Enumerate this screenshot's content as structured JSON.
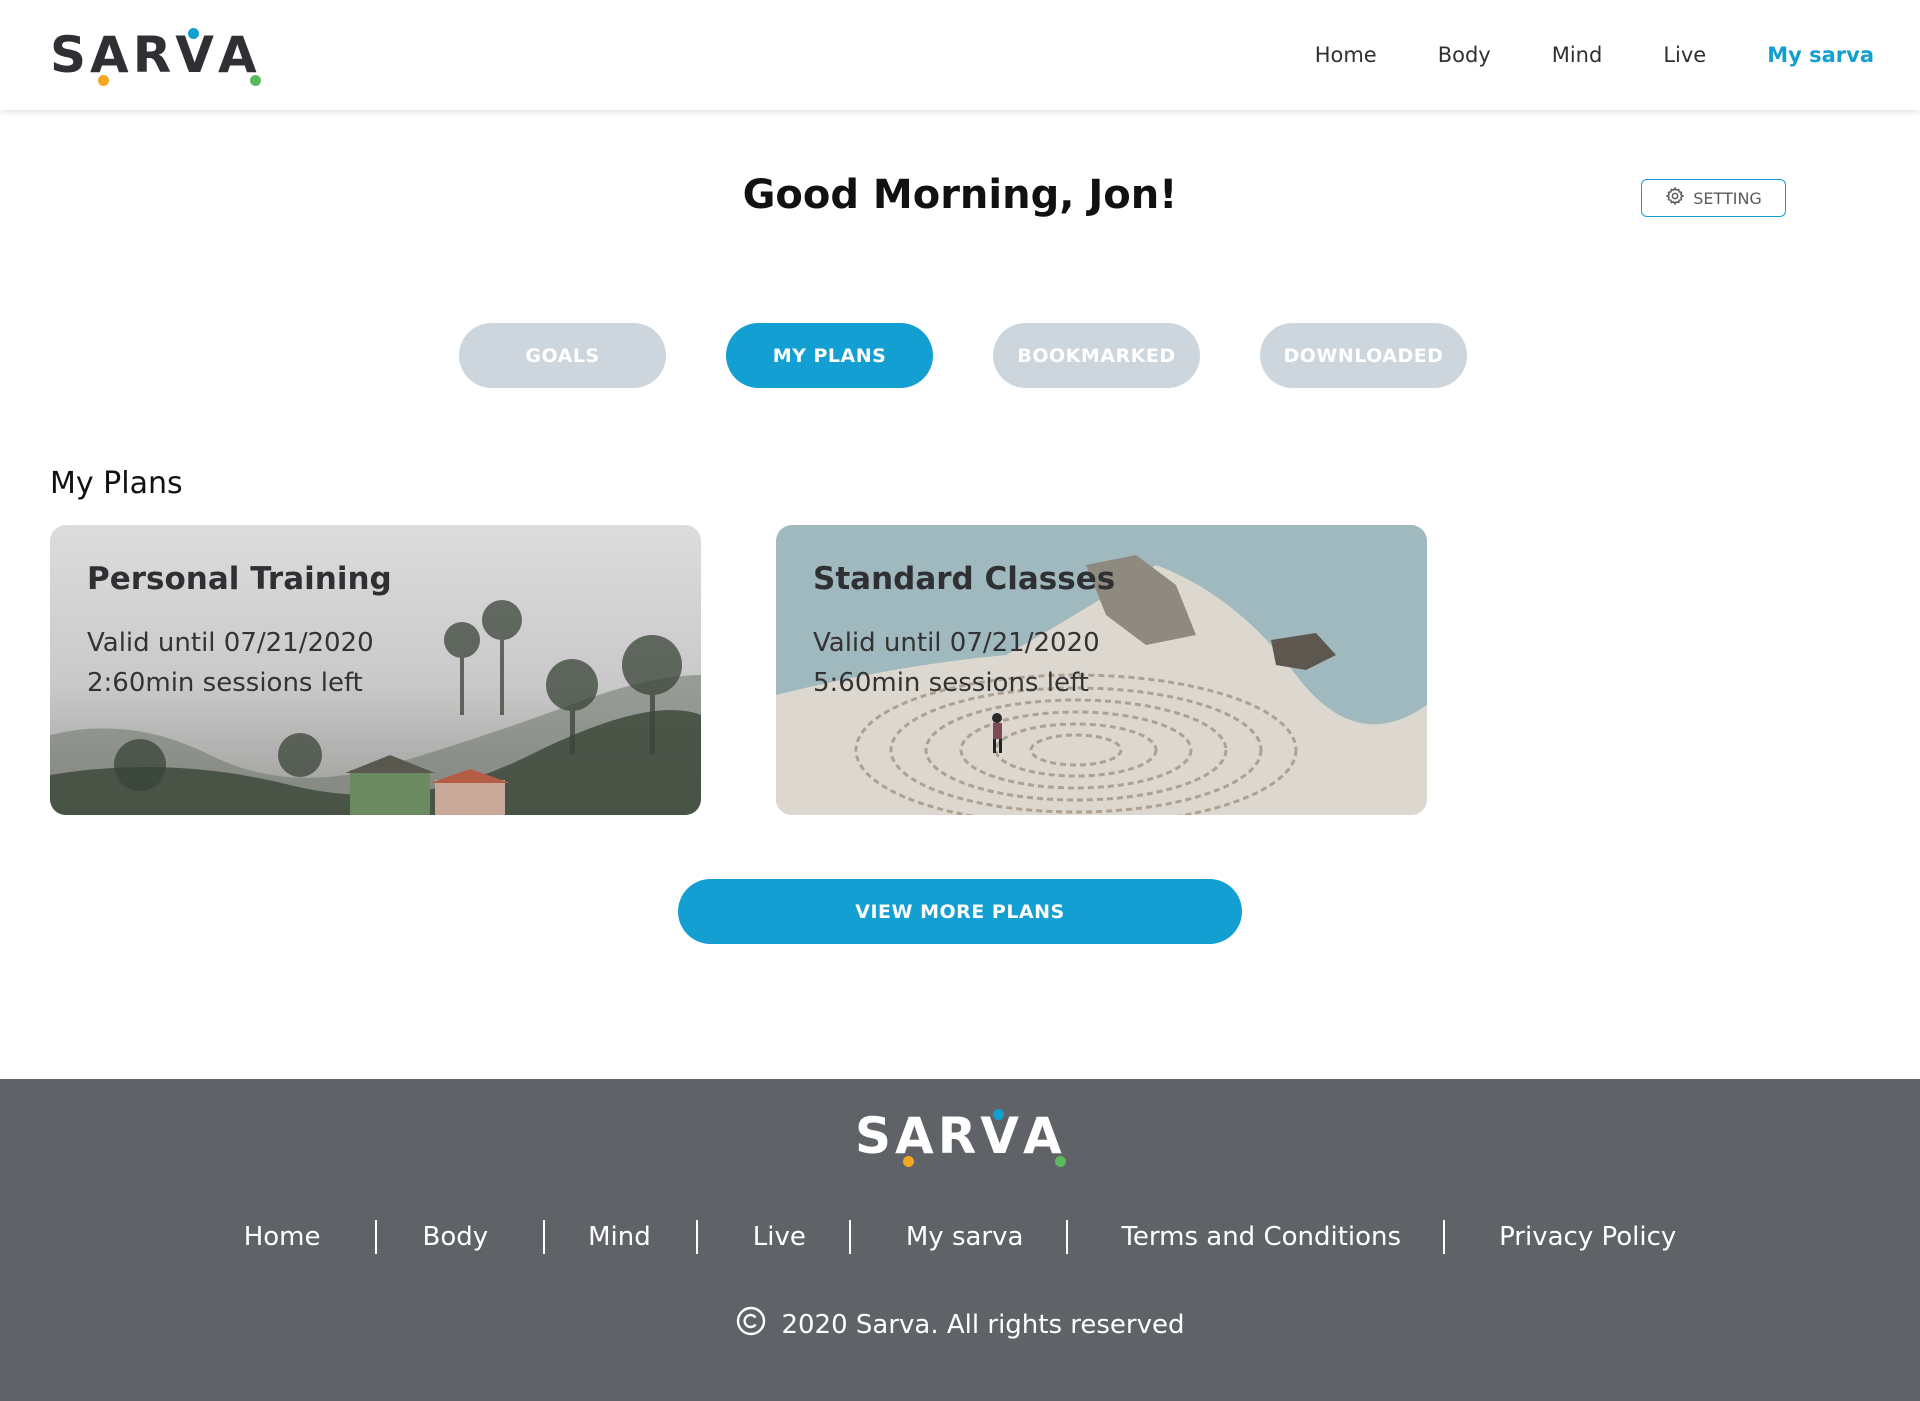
{
  "brand": {
    "name_letters": [
      "S",
      "A",
      "R",
      "V",
      "A"
    ],
    "dot_colors": [
      "#f5a623",
      "#139fd1",
      "#5cb85c"
    ]
  },
  "header": {
    "nav": [
      {
        "label": "Home",
        "active": false
      },
      {
        "label": "Body",
        "active": false
      },
      {
        "label": "Mind",
        "active": false
      },
      {
        "label": "Live",
        "active": false
      },
      {
        "label": "My sarva",
        "active": true
      }
    ]
  },
  "main": {
    "greeting": "Good Morning, Jon!",
    "setting_label": "SETTING",
    "tabs": [
      {
        "label": "GOALS",
        "active": false
      },
      {
        "label": "MY PLANS",
        "active": true
      },
      {
        "label": "BOOKMARKED",
        "active": false
      },
      {
        "label": "DOWNLOADED",
        "active": false
      }
    ],
    "section_title": "My Plans",
    "plans": [
      {
        "title": "Personal Training",
        "valid": "Valid until 07/21/2020",
        "sessions": "2:60min sessions left"
      },
      {
        "title": "Standard Classes",
        "valid": "Valid until 07/21/2020",
        "sessions": "5:60min sessions left"
      }
    ],
    "view_more_label": "VIEW MORE PLANS"
  },
  "footer": {
    "links": [
      "Home",
      "Body",
      "Mind",
      "Live",
      "My sarva",
      "Terms and Conditions",
      "Privacy Policy"
    ],
    "copyright": "2020 Sarva. All rights reserved"
  },
  "colors": {
    "accent": "#139fd1",
    "tab_inactive": "#cdd5dd",
    "footer_bg": "#5f6367"
  },
  "icons": {
    "setting": "gear-icon",
    "copyright": "copyright-icon"
  }
}
